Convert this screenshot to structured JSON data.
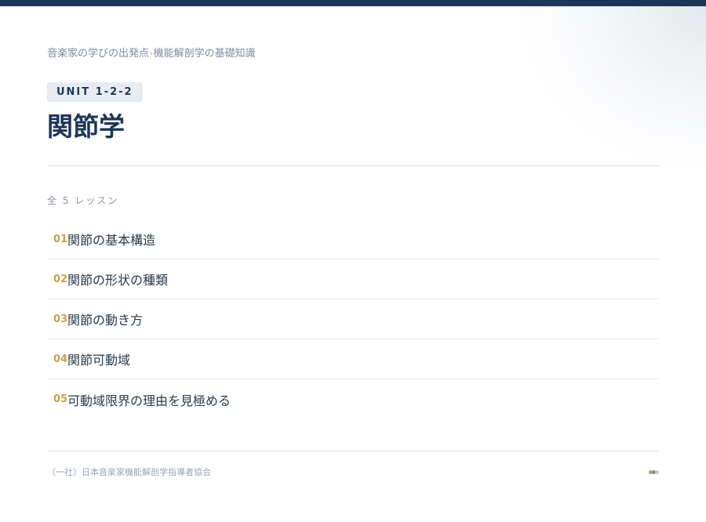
{
  "header": {
    "breadcrumb": {
      "parent": "音楽家の学びの出発点",
      "separator": "›",
      "current": "機能解剖学の基礎知識"
    },
    "unit_label": "UNIT 1-2-2",
    "title": "関節学"
  },
  "lessons": {
    "count_label": "全 5 レッスン",
    "items": [
      {
        "number": "01",
        "title": "関節の基本構造"
      },
      {
        "number": "02",
        "title": "関節の形状の種類"
      },
      {
        "number": "03",
        "title": "関節の動き方"
      },
      {
        "number": "04",
        "title": "関節可動域"
      },
      {
        "number": "05",
        "title": "可動域限界の理由を見極める"
      }
    ]
  },
  "footer": {
    "organization": "（一社）日本音楽家機能解剖学指導者協会",
    "dots": [
      "#c9a24c",
      "#7f8b99",
      "#c2c9d2"
    ]
  },
  "colors": {
    "accent_navy": "#1b3656",
    "accent_gold": "#c9a24c"
  }
}
